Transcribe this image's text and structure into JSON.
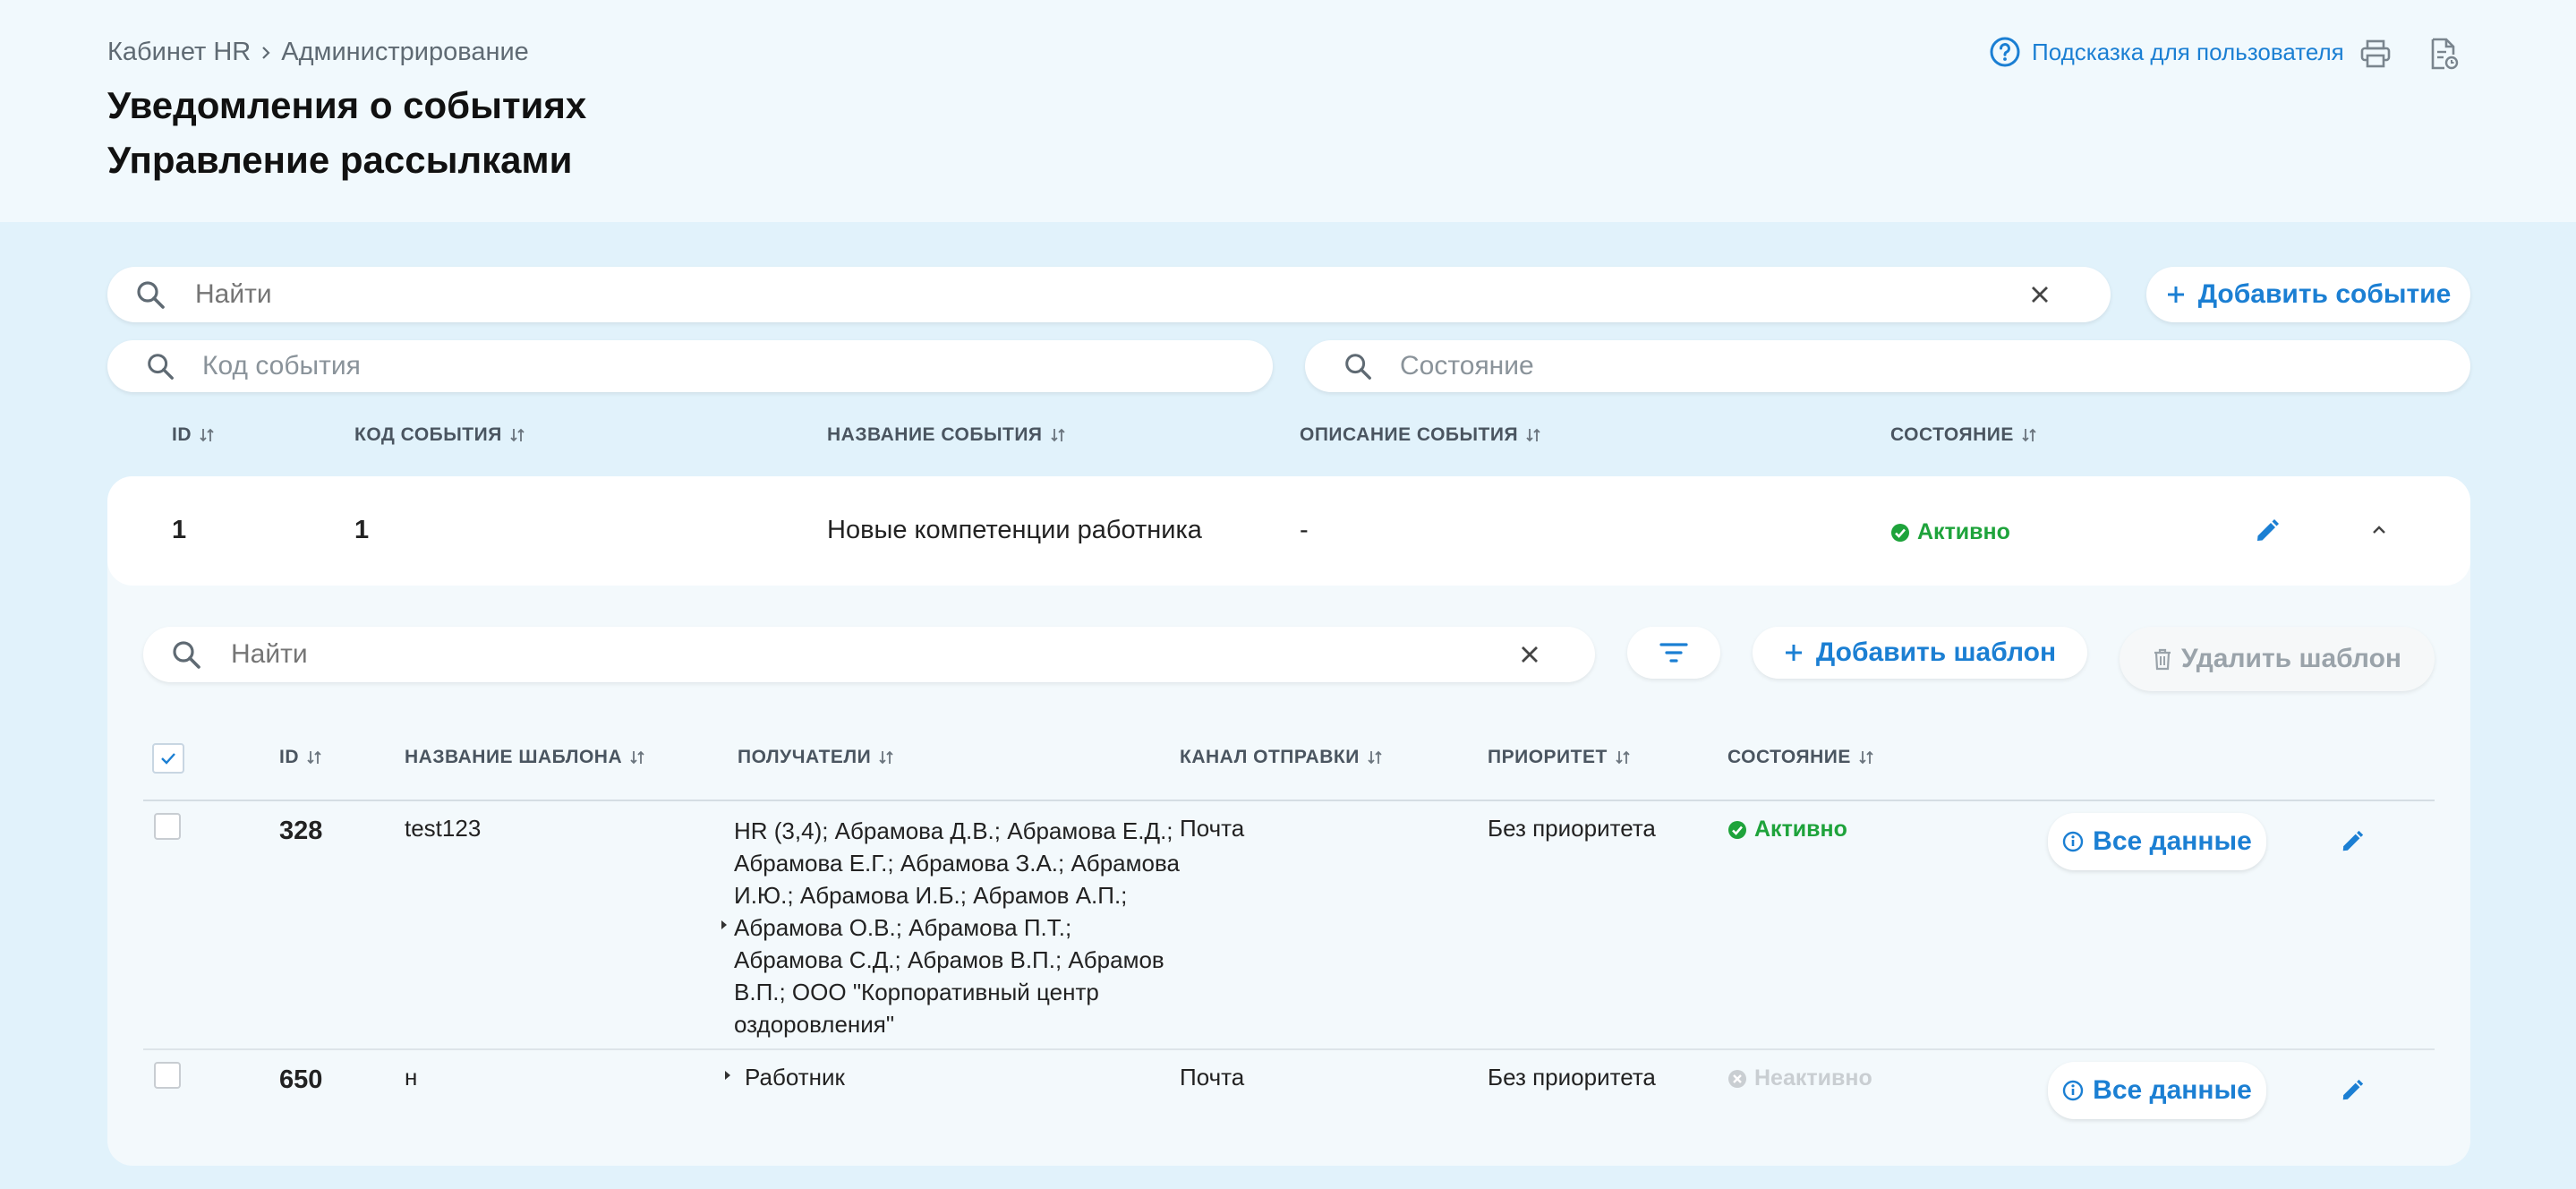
{
  "breadcrumb": {
    "home": "Кабинет HR",
    "current": "Администрирование"
  },
  "title_line1": "Уведомления о событиях",
  "title_line2": "Управление рассылками",
  "help": {
    "label": "Подсказка для пользователя"
  },
  "search": {
    "placeholder": "Найти"
  },
  "add_event_label": "Добавить событие",
  "filters": {
    "code_placeholder": "Код события",
    "state_placeholder": "Состояние"
  },
  "events_columns": [
    "ID",
    "КОД СОБЫТИЯ",
    "НАЗВАНИЕ СОБЫТИЯ",
    "ОПИСАНИЕ СОБЫТИЯ",
    "СОСТОЯНИЕ"
  ],
  "event": {
    "id": "1",
    "code": "1",
    "name": "Новые компетенции работника",
    "description": "-",
    "status": "Активно"
  },
  "templates": {
    "search_placeholder": "Найти",
    "add_label": "Добавить шаблон",
    "delete_label": "Удалить шаблон",
    "columns": [
      "ID",
      "НАЗВАНИЕ ШАБЛОНА",
      "ПОЛУЧАТЕЛИ",
      "КАНАЛ ОТПРАВКИ",
      "ПРИОРИТЕТ",
      "СОСТОЯНИЕ"
    ],
    "rows": [
      {
        "id": "328",
        "name": "test123",
        "recipients": [
          "HR (3,4); Абрамова Д.В.; Абрамова Е.Д.;",
          "Абрамова Е.Г.; Абрамова З.А.; Абрамова",
          "И.Ю.; Абрамова И.Б.; Абрамов А.П.;",
          "Абрамова О.В.; Абрамова П.Т.;",
          "Абрамова С.Д.; Абрамов В.П.; Абрамов",
          "В.П.; ООО \"Корпоративный центр",
          "оздоровления\""
        ],
        "channel": "Почта",
        "priority": "Без приоритета",
        "status": "Активно",
        "details_label": "Все данные"
      },
      {
        "id": "650",
        "name": "н",
        "recipients": [
          "Работник"
        ],
        "channel": "Почта",
        "priority": "Без приоритета",
        "status": "Неактивно",
        "details_label": "Все данные"
      }
    ]
  },
  "colors": {
    "accent": "#1b7fd3",
    "active": "#1ea33b",
    "inactive": "#c9ced2",
    "background": "#e1f2fb"
  }
}
